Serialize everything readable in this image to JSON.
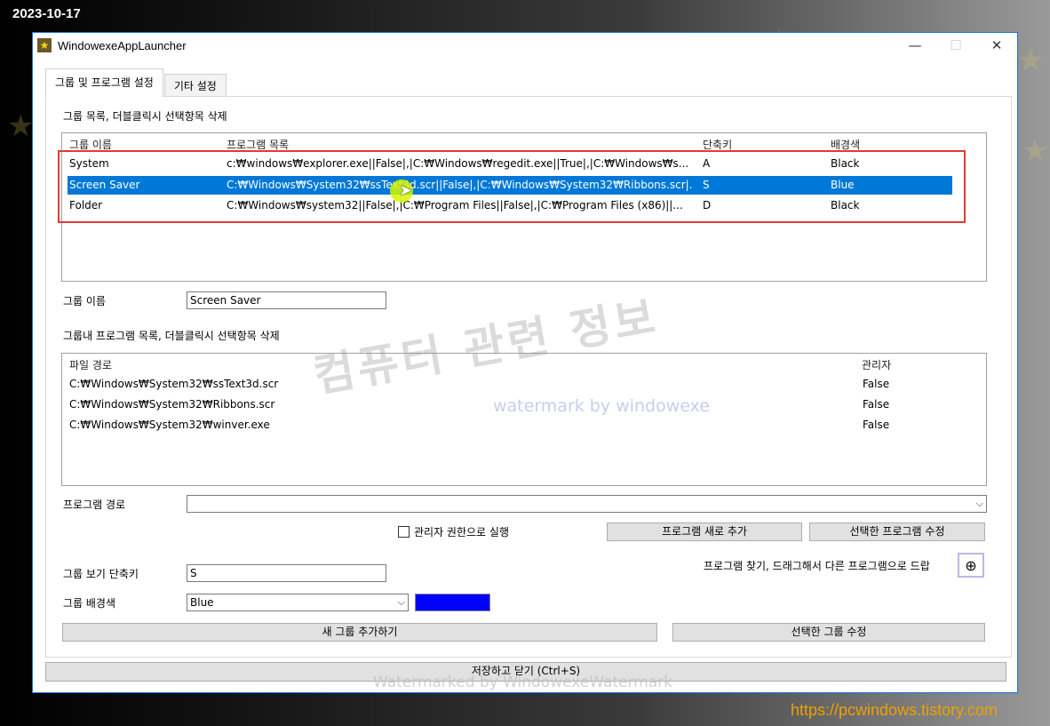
{
  "date_stamp": "2023-10-17",
  "window": {
    "title": "WindowexeAppLauncher",
    "minimize": "—",
    "maximize": "☐",
    "close": "✕"
  },
  "tabs": [
    {
      "label": "그룹 및 프로그램 설정"
    },
    {
      "label": "기타 설정"
    }
  ],
  "group_list": {
    "label": "그룹 목록, 더블클릭시 선택항목 삭제",
    "columns": [
      "그룹 이름",
      "프로그램 목록",
      "단축키",
      "배경색"
    ],
    "rows": [
      {
        "name": "System",
        "programs": "c:₩windows₩explorer.exe||False|,|C:₩Windows₩regedit.exe||True|,|C:₩Windows₩s...",
        "hotkey": "A",
        "color": "Black"
      },
      {
        "name": "Screen Saver",
        "programs": "C:₩Windows₩System32₩ssText3d.scr||False|,|C:₩Windows₩System32₩Ribbons.scr|...",
        "hotkey": "S",
        "color": "Blue"
      },
      {
        "name": "Folder",
        "programs": "C:₩Windows₩system32||False|,|C:₩Program Files||False|,|C:₩Program Files (x86)||...",
        "hotkey": "D",
        "color": "Black"
      }
    ]
  },
  "group_name": {
    "label": "그룹 이름",
    "value": "Screen Saver"
  },
  "program_list": {
    "label": "그룹내 프로그램 목록, 더블클릭시 선택항목 삭제",
    "columns": [
      "파일 경로",
      "관리자"
    ],
    "rows": [
      {
        "path": "C:₩Windows₩System32₩ssText3d.scr",
        "admin": "False"
      },
      {
        "path": "C:₩Windows₩System32₩Ribbons.scr",
        "admin": "False"
      },
      {
        "path": "C:₩Windows₩System32₩winver.exe",
        "admin": "False"
      }
    ]
  },
  "program_path": {
    "label": "프로그램 경로",
    "value": ""
  },
  "run_as_admin": {
    "label": "관리자 권한으로 실행",
    "checked": false
  },
  "buttons": {
    "add_program": "프로그램 새로 추가",
    "edit_program": "선택한 프로그램 수정",
    "add_group": "새 그룹 추가하기",
    "edit_group": "선택한 그룹 수정",
    "save_close": "저장하고 닫기 (Ctrl+S)"
  },
  "find_program": {
    "label": "프로그램 찾기, 드래그해서 다른 프로그램으로 드랍"
  },
  "hotkey": {
    "label": "그룹 보기 단축키",
    "value": "S"
  },
  "bgcolor": {
    "label": "그룹 배경색",
    "value": "Blue",
    "swatch": "#0000ff"
  },
  "watermarks": {
    "big": "컴퓨터 관련 정보",
    "small": "watermark by windowexe",
    "bottom": "Watermarked by WindowexeWatermark",
    "url": "https://pcwindows.tistory.com"
  },
  "colors": {
    "selection": "#0078d7",
    "highlight_box": "#e53935",
    "accent": "#1a73e8"
  }
}
